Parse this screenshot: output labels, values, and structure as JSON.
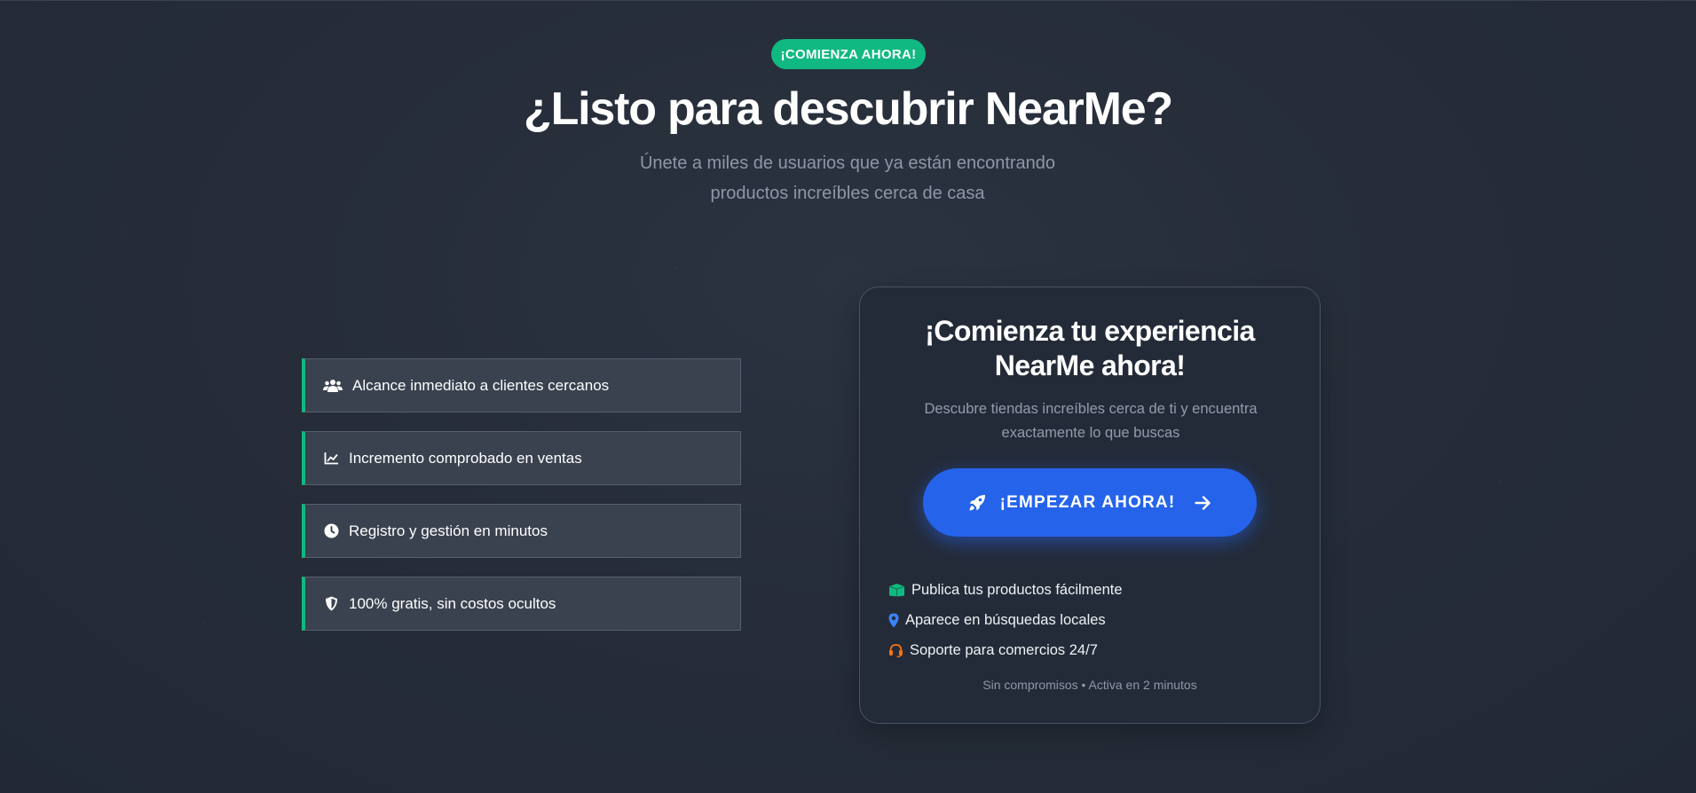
{
  "hero": {
    "badge": "¡COMIENZA AHORA!",
    "title": "¿Listo para descubrir NearMe?",
    "subtitle_line1": "Únete a miles de usuarios que ya están encontrando",
    "subtitle_line2": "productos increíbles cerca de casa"
  },
  "features": [
    {
      "label": "Alcance inmediato a clientes cercanos",
      "icon": "users-icon"
    },
    {
      "label": "Incremento comprobado en ventas",
      "icon": "chart-line-icon"
    },
    {
      "label": "Registro y gestión en minutos",
      "icon": "clock-icon"
    },
    {
      "label": "100% gratis, sin costos ocultos",
      "icon": "shield-icon"
    }
  ],
  "card": {
    "title_line1": "¡Comienza tu experiencia",
    "title_line2": "NearMe ahora!",
    "subtitle_line1": "Descubre tiendas increíbles cerca de ti y encuentra",
    "subtitle_line2": "exactamente lo que buscas",
    "cta_label": "¡EMPEZAR AHORA!",
    "perks": [
      {
        "label": "Publica tus productos fácilmente",
        "icon": "box-icon",
        "color": "#10b981"
      },
      {
        "label": "Aparece en búsquedas locales",
        "icon": "map-pin-icon",
        "color": "#3b82f6"
      },
      {
        "label": "Soporte para comercios 24/7",
        "icon": "headset-icon",
        "color": "#f97316"
      }
    ],
    "footnote": "Sin compromisos • Activa en 2 minutos"
  },
  "colors": {
    "accent_green": "#10b981",
    "primary_blue": "#2563eb",
    "background": "#252c38"
  }
}
